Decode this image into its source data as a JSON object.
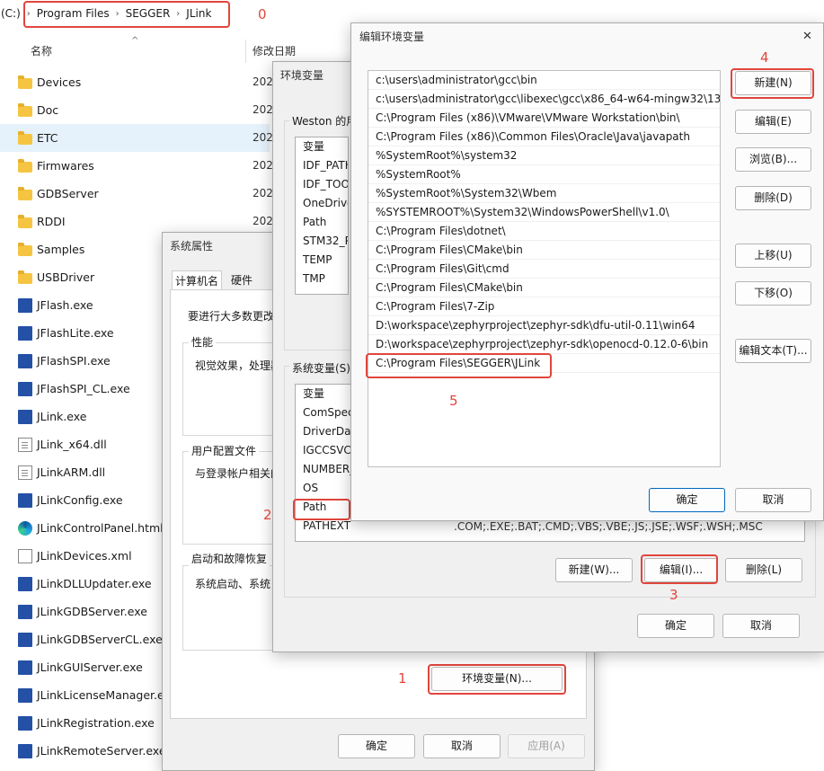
{
  "explorer": {
    "breadcrumb": [
      "(C:)",
      "Program Files",
      "SEGGER",
      "JLink"
    ],
    "col_name": "名称",
    "col_date": "修改日期",
    "files": [
      {
        "name": "Devices",
        "icon": "folder-icon",
        "date": "202"
      },
      {
        "name": "Doc",
        "icon": "folder-icon",
        "date": "202"
      },
      {
        "name": "ETC",
        "icon": "folder-icon",
        "date": "202"
      },
      {
        "name": "Firmwares",
        "icon": "folder-icon",
        "date": "202"
      },
      {
        "name": "GDBServer",
        "icon": "folder-icon",
        "date": "202"
      },
      {
        "name": "RDDI",
        "icon": "folder-icon",
        "date": "202"
      },
      {
        "name": "Samples",
        "icon": "folder-icon",
        "date": ""
      },
      {
        "name": "USBDriver",
        "icon": "folder-icon",
        "date": ""
      },
      {
        "name": "JFlash.exe",
        "icon": "exe-icon",
        "date": ""
      },
      {
        "name": "JFlashLite.exe",
        "icon": "exe-icon",
        "date": ""
      },
      {
        "name": "JFlashSPI.exe",
        "icon": "exe-icon",
        "date": ""
      },
      {
        "name": "JFlashSPI_CL.exe",
        "icon": "exe-icon",
        "date": ""
      },
      {
        "name": "JLink.exe",
        "icon": "exe-icon",
        "date": ""
      },
      {
        "name": "JLink_x64.dll",
        "icon": "dll-icon",
        "date": ""
      },
      {
        "name": "JLinkARM.dll",
        "icon": "dll-icon",
        "date": ""
      },
      {
        "name": "JLinkConfig.exe",
        "icon": "exe-icon",
        "date": ""
      },
      {
        "name": "JLinkControlPanel.html",
        "icon": "edge-icon",
        "date": ""
      },
      {
        "name": "JLinkDevices.xml",
        "icon": "xml-icon",
        "date": ""
      },
      {
        "name": "JLinkDLLUpdater.exe",
        "icon": "exe-icon",
        "date": ""
      },
      {
        "name": "JLinkGDBServer.exe",
        "icon": "exe-icon",
        "date": ""
      },
      {
        "name": "JLinkGDBServerCL.exe",
        "icon": "exe-icon",
        "date": ""
      },
      {
        "name": "JLinkGUIServer.exe",
        "icon": "exe-icon",
        "date": ""
      },
      {
        "name": "JLinkLicenseManager.exe",
        "icon": "exe-icon",
        "date": ""
      },
      {
        "name": "JLinkRegistration.exe",
        "icon": "exe-icon",
        "date": ""
      },
      {
        "name": "JLinkRemoteServer.exe",
        "icon": "exe-icon",
        "date": ""
      }
    ]
  },
  "sysprops": {
    "title": "系统属性",
    "tabs": [
      "计算机名",
      "硬件"
    ],
    "intro": "要进行大多数更改",
    "perf_label": "性能",
    "perf_text": "视觉效果，处理器",
    "profile_label": "用户配置文件",
    "profile_text": "与登录帐户相关的",
    "startup_label": "启动和故障恢复",
    "startup_text": "系统启动、系统",
    "env_button": "环境变量(N)...",
    "ok": "确定",
    "cancel": "取消",
    "apply": "应用(A)"
  },
  "envvars": {
    "title": "环境变量",
    "user_label": "Weston 的用",
    "user_header": "变量",
    "user_vars": [
      "IDF_PATH",
      "IDF_TOOL",
      "OneDrive",
      "Path",
      "STM32_PR",
      "TEMP",
      "TMP"
    ],
    "sys_label": "系统变量(S)",
    "sys_header": "变量",
    "sys_vars": [
      "ComSpec",
      "DriverDat",
      "IGCCSVC_",
      "NUMBER_",
      "OS",
      "Path",
      "PATHEXT"
    ],
    "pathext_value": ".COM;.EXE;.BAT;.CMD;.VBS;.VBE;.JS;.JSE;.WSF;.WSH;.MSC",
    "new_button": "新建(W)...",
    "edit_button": "编辑(I)...",
    "delete_button": "删除(L)",
    "ok": "确定",
    "cancel": "取消"
  },
  "editenv": {
    "title": "编辑环境变量",
    "paths": [
      "c:\\users\\administrator\\gcc\\bin",
      "c:\\users\\administrator\\gcc\\libexec\\gcc\\x86_64-w64-mingw32\\13...",
      "C:\\Program Files (x86)\\VMware\\VMware Workstation\\bin\\",
      "C:\\Program Files (x86)\\Common Files\\Oracle\\Java\\javapath",
      "%SystemRoot%\\system32",
      "%SystemRoot%",
      "%SystemRoot%\\System32\\Wbem",
      "%SYSTEMROOT%\\System32\\WindowsPowerShell\\v1.0\\",
      "C:\\Program Files\\dotnet\\",
      "C:\\Program Files\\CMake\\bin",
      "C:\\Program Files\\Git\\cmd",
      "C:\\Program Files\\CMake\\bin",
      "C:\\Program Files\\7-Zip",
      "D:\\workspace\\zephyrproject\\zephyr-sdk\\dfu-util-0.11\\win64",
      "D:\\workspace\\zephyrproject\\zephyr-sdk\\openocd-0.12.0-6\\bin",
      "C:\\Program Files\\SEGGER\\JLink"
    ],
    "btn_new": "新建(N)",
    "btn_edit": "编辑(E)",
    "btn_browse": "浏览(B)...",
    "btn_delete": "删除(D)",
    "btn_up": "上移(U)",
    "btn_down": "下移(O)",
    "btn_edittext": "编辑文本(T)...",
    "ok": "确定",
    "cancel": "取消",
    "close_glyph": "✕"
  },
  "annotations": {
    "n0": "0",
    "n1": "1",
    "n2": "2",
    "n3": "3",
    "n4": "4",
    "n5": "5"
  },
  "colors": {
    "annotation": "#e0463c",
    "selection": "#e5f1fb",
    "folder": "#f5c542"
  }
}
